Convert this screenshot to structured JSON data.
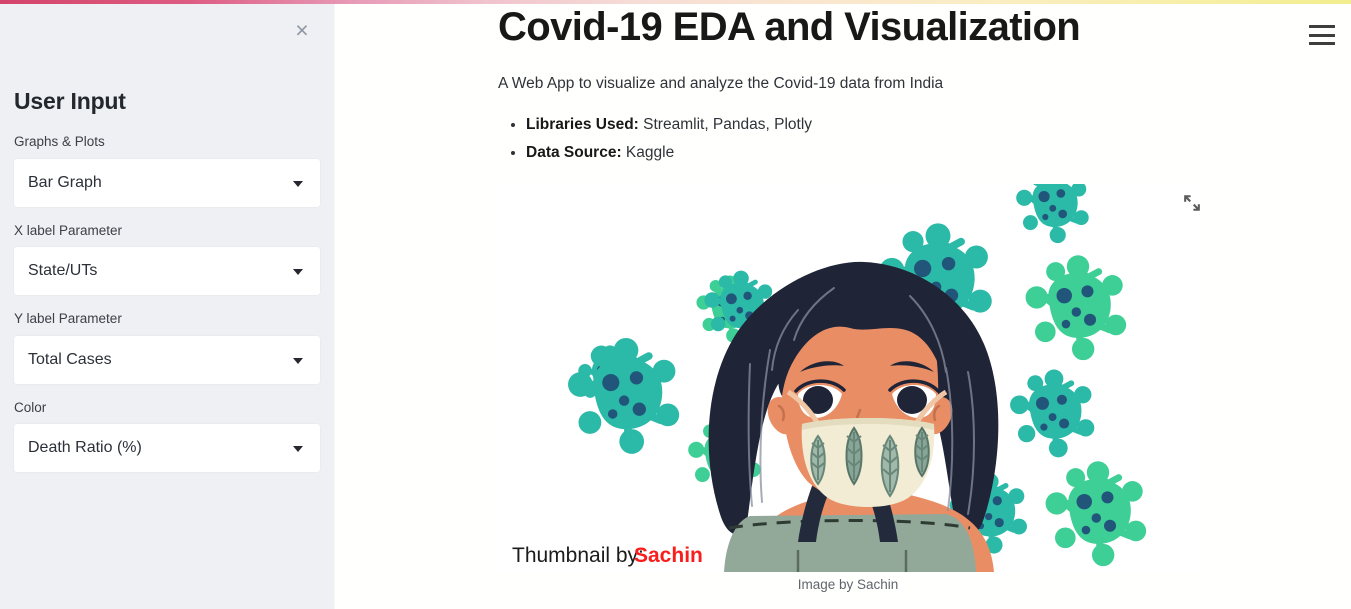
{
  "window": {
    "background_color": "#fffffd",
    "accent_gradient_from": "#d4446a",
    "accent_gradient_to": "#f3ee8e"
  },
  "sidebar": {
    "background_color": "#eef0f3",
    "close_label": "×",
    "title": "User Input",
    "fields": [
      {
        "label": "Graphs & Plots",
        "value": "Bar Graph"
      },
      {
        "label": "X label Parameter",
        "value": "State/UTs"
      },
      {
        "label": "Y label Parameter",
        "value": "Total Cases"
      },
      {
        "label": "Color",
        "value": "Death Ratio (%)"
      }
    ]
  },
  "header": {
    "menu_icon": "hamburger-menu-icon"
  },
  "main": {
    "title": "Covid-19 EDA and Visualization",
    "subtitle": "A Web App to visualize and analyze the Covid-19 data from India",
    "bullets": [
      {
        "lead": "Libraries Used:",
        "rest": " Streamlit, Pandas, Plotly"
      },
      {
        "lead": "Data Source:",
        "rest": " Kaggle"
      }
    ],
    "image": {
      "expand_icon": "expand-fullscreen-icon",
      "overlay_text_prefix": "Thumbnail by:",
      "overlay_text_name": "Sachin",
      "overlay_name_color": "#fb1c1c",
      "caption": "Image by Sachin",
      "colors": {
        "virus_teal": "#2bb9a8",
        "virus_green": "#3ecf96",
        "virus_dot": "#21557a",
        "hair": "#1f2436",
        "skin": "#e98d65",
        "mask": "#f2ecd4",
        "mask_leaf": "#5e7f72",
        "shirt": "#92a99a",
        "strap": "#232a3c"
      }
    }
  }
}
